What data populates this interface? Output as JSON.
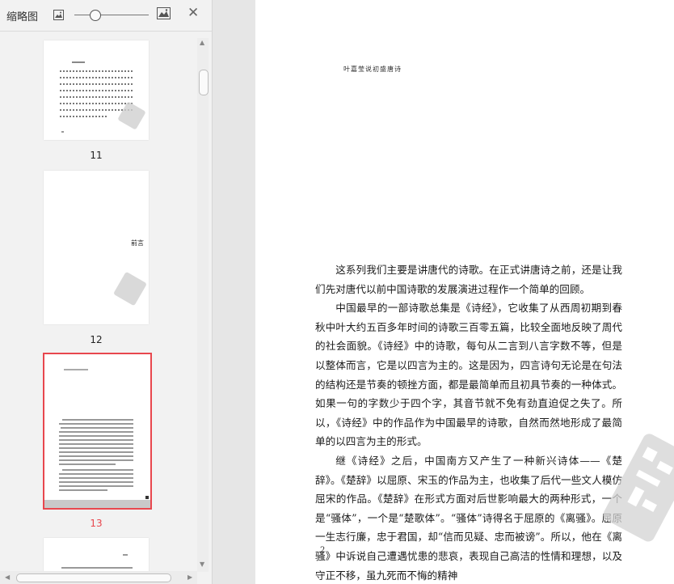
{
  "thumbnail_panel": {
    "title": "缩略图",
    "close_glyph": "✕",
    "zoom_slider": {
      "value_fraction": 0.28
    },
    "pages": [
      {
        "label": "11",
        "selected": false
      },
      {
        "label": "12",
        "selected": false,
        "heading": "前言"
      },
      {
        "label": "13",
        "selected": true
      },
      {
        "label": "",
        "selected": false
      }
    ],
    "selected_color": "#e8474e"
  },
  "document": {
    "running_header": "叶嘉莹说初盛唐诗",
    "page_number": "2",
    "paragraphs": [
      "这系列我们主要是讲唐代的诗歌。在正式讲唐诗之前，还是让我们先对唐代以前中国诗歌的发展演进过程作一个简单的回顾。",
      "中国最早的一部诗歌总集是《诗经》，它收集了从西周初期到春秋中叶大约五百多年时间的诗歌三百零五篇，比较全面地反映了周代的社会面貌。《诗经》中的诗歌，每句从二言到八言字数不等，但是以整体而言，它是以四言为主的。这是因为，四言诗句无论是在句法的结构还是节奏的顿挫方面，都是最简单而且初具节奏的一种体式。如果一句的字数少于四个字，其音节就不免有劲直迫促之失了。所以，《诗经》中的作品作为中国最早的诗歌，自然而然地形成了最简单的以四言为主的形式。",
      "继《诗经》之后，中国南方又产生了一种新兴诗体——《楚辞》。《楚辞》以屈原、宋玉的作品为主，也收集了后代一些文人模仿屈宋的作品。《楚辞》在形式方面对后世影响最大的两种形式，一个是“骚体”，一个是“楚歌体”。“骚体”诗得名于屈原的《离骚》。屈原一生志行廉，忠于君国，却“信而见疑、忠而被谤”。所以，他在《离骚》中诉说自己遭遇忧患的悲哀，表现自己高洁的性情和理想，以及守正不移，虽九死而不悔的精神"
    ]
  }
}
